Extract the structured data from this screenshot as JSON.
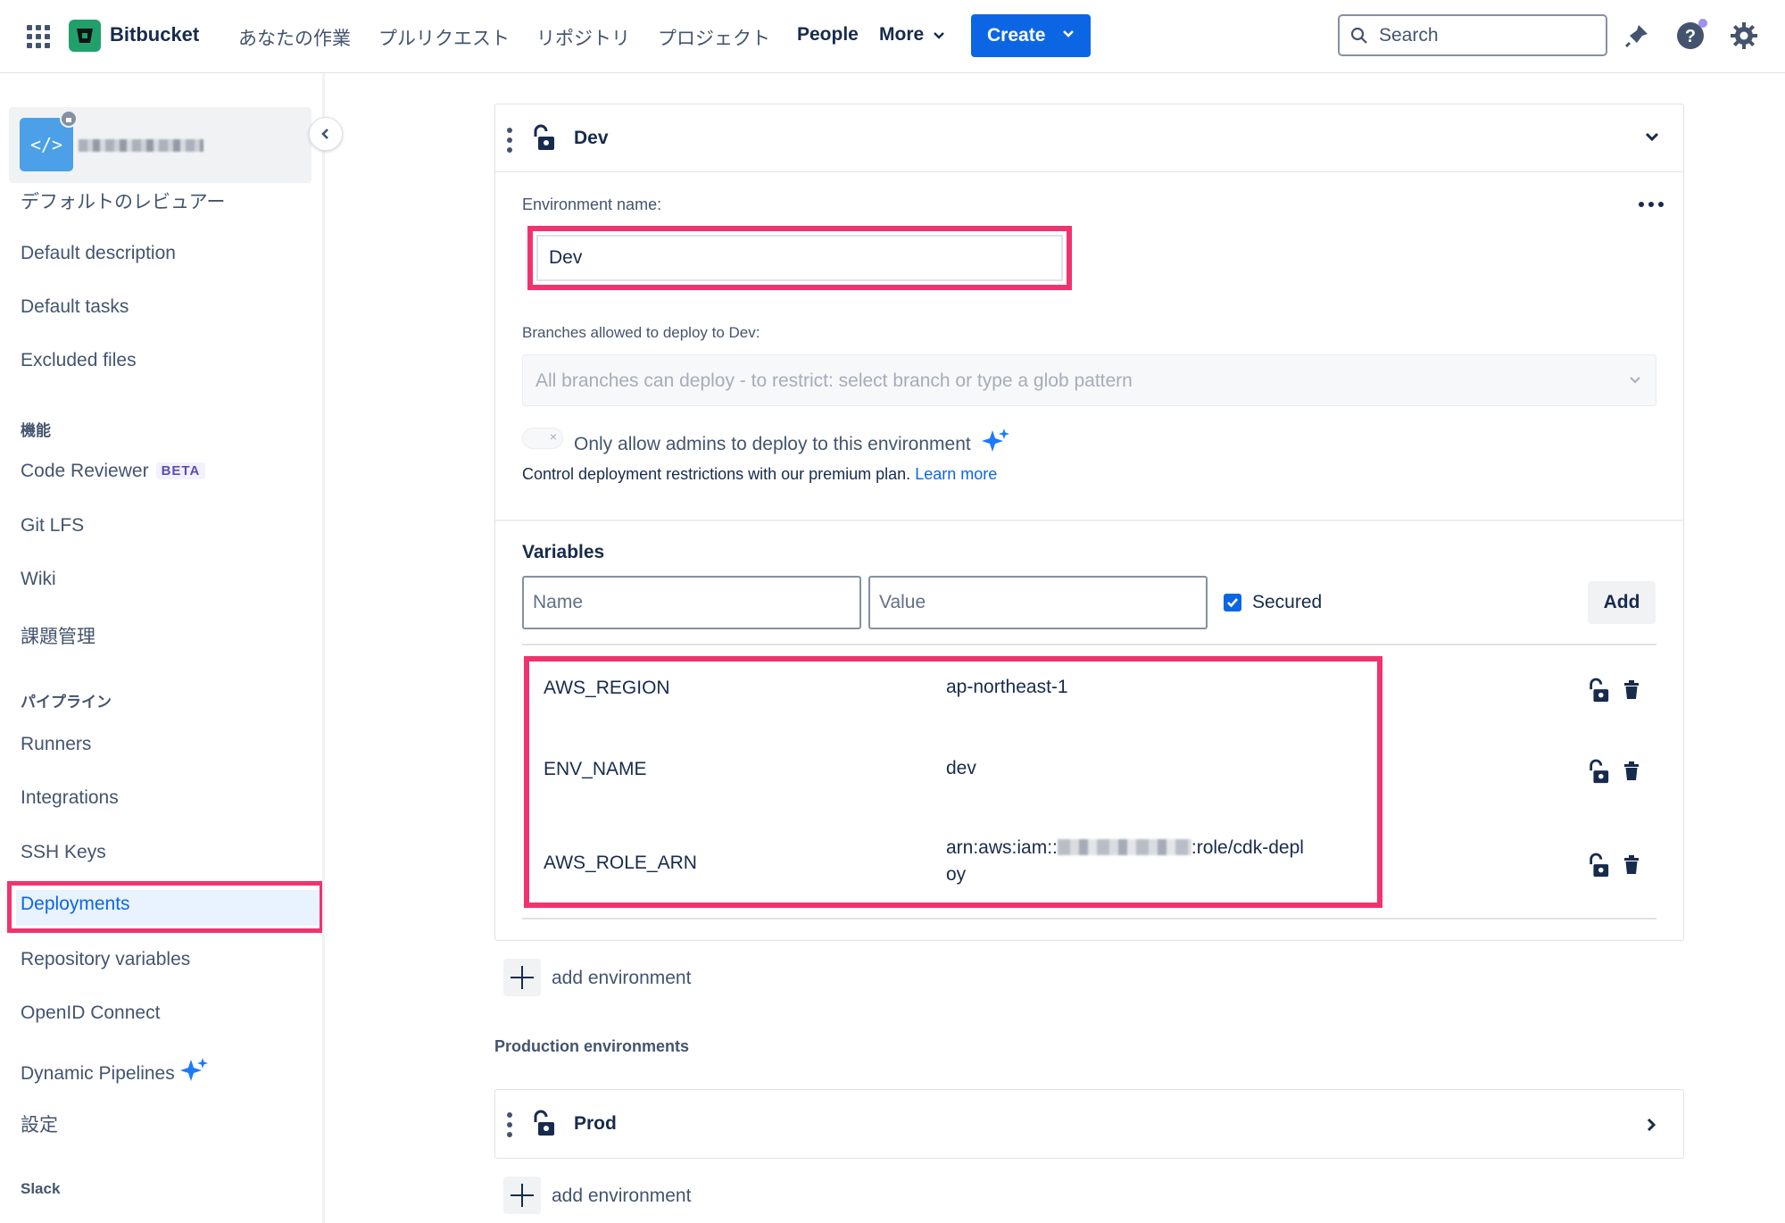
{
  "topnav": {
    "brand": "Bitbucket",
    "items": [
      "あなたの作業",
      "プルリクエスト",
      "リポジトリ",
      "プロジェクト",
      "People",
      "More"
    ],
    "create_label": "Create",
    "search_placeholder": "Search"
  },
  "sidebar": {
    "partial_item": "デフォルトのレビュアー",
    "items_top": [
      "Default description",
      "Default tasks",
      "Excluded files"
    ],
    "section_features": "機能",
    "code_reviewer": "Code Reviewer",
    "beta_badge": "BETA",
    "features": [
      "Git LFS",
      "Wiki",
      "課題管理"
    ],
    "section_pipelines": "パイプライン",
    "pipelines": [
      "Runners",
      "Integrations",
      "SSH Keys"
    ],
    "active_item": "Deployments",
    "pipelines_after": [
      "Repository variables",
      "OpenID Connect"
    ],
    "dynamic_pipelines": "Dynamic Pipelines",
    "settings": "設定",
    "section_slack": "Slack"
  },
  "dev_env": {
    "title": "Dev",
    "env_name_label": "Environment name:",
    "env_name_value": "Dev",
    "branches_label": "Branches allowed to deploy to Dev:",
    "branches_placeholder": "All branches can deploy - to restrict: select branch or type a glob pattern",
    "admin_toggle_label": "Only allow admins to deploy to this environment",
    "premium_text": "Control deployment restrictions with our premium plan.",
    "learn_more": "Learn more",
    "variables_title": "Variables",
    "name_placeholder": "Name",
    "value_placeholder": "Value",
    "secured_label": "Secured",
    "add_label": "Add",
    "variables": [
      {
        "name": "AWS_REGION",
        "value": "ap-northeast-1"
      },
      {
        "name": "ENV_NAME",
        "value": "dev"
      },
      {
        "name": "AWS_ROLE_ARN",
        "value_prefix": "arn:aws:iam::",
        "value_suffix": ":role/cdk-depl",
        "value_wrap": "oy"
      }
    ]
  },
  "add_environment_label": "add environment",
  "production_section": "Production environments",
  "prod_env": {
    "title": "Prod"
  },
  "colors": {
    "accent": "#0c66e4",
    "highlight": "#f0336e",
    "logo": "#22a06b"
  }
}
